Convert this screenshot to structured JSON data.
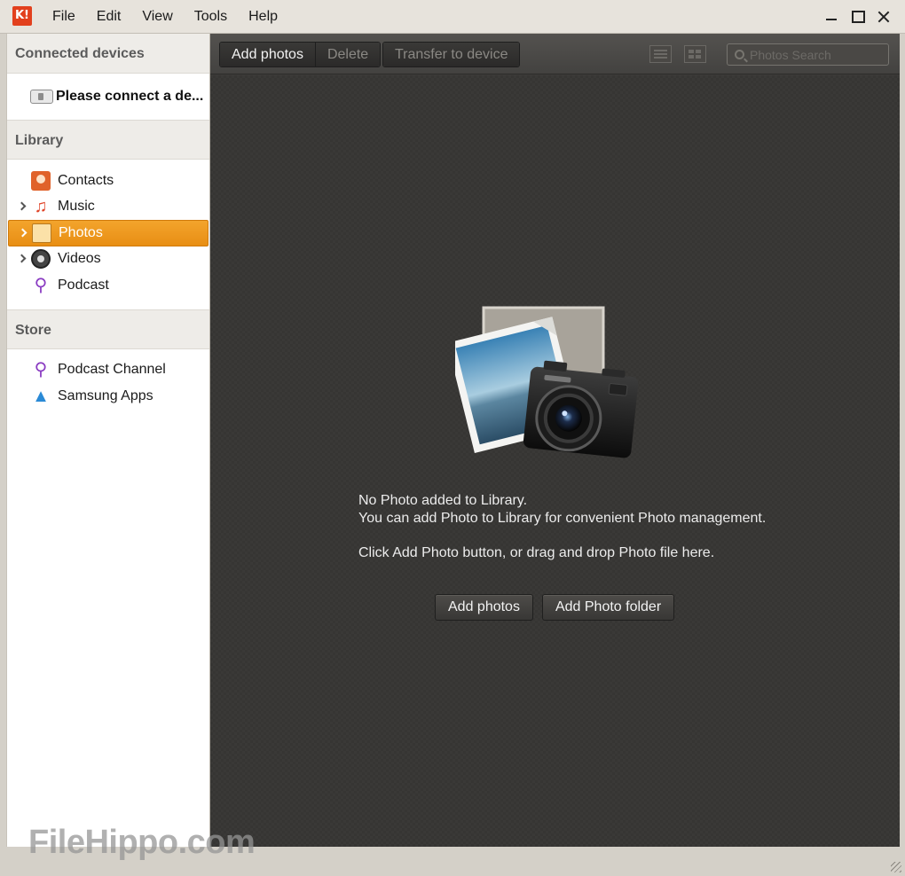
{
  "app": {
    "logo_text": "K!",
    "menu": [
      {
        "label": "File"
      },
      {
        "label": "Edit"
      },
      {
        "label": "View"
      },
      {
        "label": "Tools"
      },
      {
        "label": "Help"
      }
    ]
  },
  "sidebar": {
    "connected_devices": {
      "header": "Connected devices",
      "device_prompt": "Please connect a de..."
    },
    "library": {
      "header": "Library",
      "items": [
        {
          "label": "Contacts",
          "icon": "contacts-icon",
          "expandable": false
        },
        {
          "label": "Music",
          "icon": "music-icon",
          "expandable": true
        },
        {
          "label": "Photos",
          "icon": "photos-icon",
          "expandable": true,
          "selected": true
        },
        {
          "label": "Videos",
          "icon": "videos-icon",
          "expandable": true
        },
        {
          "label": "Podcast",
          "icon": "podcast-icon",
          "expandable": false
        }
      ]
    },
    "store": {
      "header": "Store",
      "items": [
        {
          "label": "Podcast Channel",
          "icon": "podcast-channel-icon"
        },
        {
          "label": "Samsung Apps",
          "icon": "samsung-apps-icon"
        }
      ]
    }
  },
  "toolbar": {
    "add_photos": "Add photos",
    "delete": "Delete",
    "transfer": "Transfer to device",
    "search_placeholder": "Photos Search"
  },
  "empty_state": {
    "line1": "No Photo added to Library.",
    "line2": "You can add Photo to Library for convenient Photo management.",
    "line3": "Click Add Photo button, or drag and drop Photo file here.",
    "add_photos_button": "Add photos",
    "add_folder_button": "Add Photo folder"
  },
  "watermark": "FileHippo.com",
  "colors": {
    "accent_selected": "#f0a028",
    "main_bg": "#3a3937",
    "sidebar_bg": "#ffffff"
  }
}
